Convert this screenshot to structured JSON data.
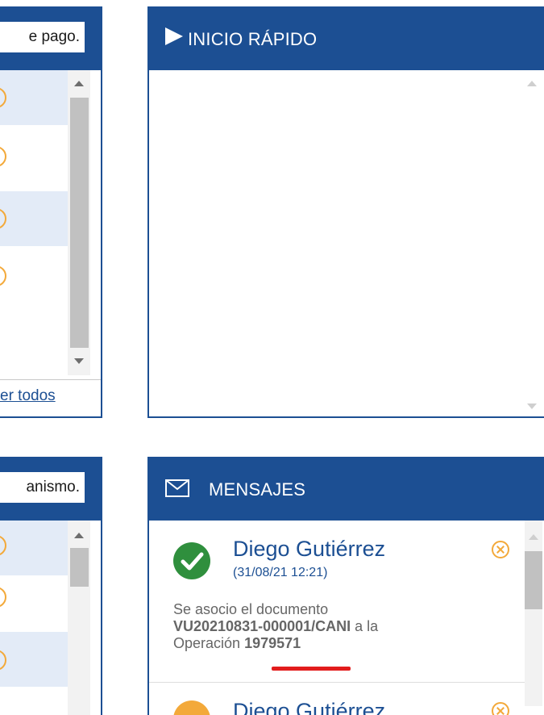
{
  "payments_panel": {
    "search_placeholder": "e pago.",
    "view_all_label": "er todos"
  },
  "organisms_panel": {
    "search_placeholder": "anismo."
  },
  "quick_start": {
    "title": "INICIO RÁPIDO",
    "icon": "play-icon"
  },
  "messages": {
    "title": "MENSAJES",
    "icon": "envelope-icon",
    "items": [
      {
        "sender": "Diego Gutiérrez",
        "date": "(31/08/21 12:21)",
        "status_icon": "check-circle-icon",
        "text_prefix": "Se asocio el documento",
        "document": "VU20210831-000001/CANI",
        "text_mid": "a la",
        "text_operation_label": "Operación",
        "operation": "1979571"
      },
      {
        "sender": "Diego Gutiérrez",
        "status_icon": "warning-circle-icon"
      }
    ]
  },
  "colors": {
    "brand": "#1c4f93",
    "accent": "#f3a93a",
    "success": "#2f8f3d",
    "highlight": "#e21c1c"
  }
}
